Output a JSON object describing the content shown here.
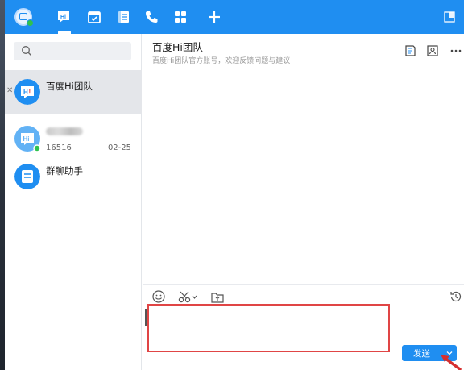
{
  "topbar": {
    "avatar_hi": "Hi",
    "nav": [
      {
        "name": "messages",
        "icon": "chat-hi-icon",
        "active": true
      },
      {
        "name": "calendar",
        "icon": "calendar-icon",
        "active": false
      },
      {
        "name": "contacts",
        "icon": "contacts-book-icon",
        "active": false
      },
      {
        "name": "phone",
        "icon": "phone-icon",
        "active": false
      },
      {
        "name": "apps",
        "icon": "apps-grid-icon",
        "active": false
      },
      {
        "name": "add",
        "icon": "plus-icon",
        "active": false
      }
    ],
    "right_icon": "window-toggle-icon"
  },
  "sidebar": {
    "search": {
      "value": "",
      "placeholder": ""
    },
    "conversations": [
      {
        "title": "百度Hi团队",
        "sub": "",
        "date": "",
        "active": true,
        "avatar": "hi-team-avatar"
      },
      {
        "title": "",
        "sub": "16516",
        "date": "02-25",
        "active": false,
        "avatar": "hi-user-avatar",
        "online": true
      },
      {
        "title": "群聊助手",
        "sub": "",
        "date": "",
        "active": false,
        "avatar": "group-assistant-avatar"
      }
    ]
  },
  "chat": {
    "title": "百度Hi团队",
    "description": "百度Hi团队官方账号，欢迎反馈问题与建议",
    "header_icons": [
      "message-record-icon",
      "contact-card-icon",
      "more-icon"
    ],
    "toolbar": [
      "emoji-icon",
      "screenshot-scissors-icon",
      "file-upload-icon",
      "history-icon"
    ],
    "input": {
      "value": "",
      "placeholder": ""
    },
    "send_label": "发送"
  },
  "colors": {
    "primary": "#1f8ef1",
    "active_row": "#e4e6ea",
    "highlight": "#e04545",
    "online": "#2fc24e"
  }
}
